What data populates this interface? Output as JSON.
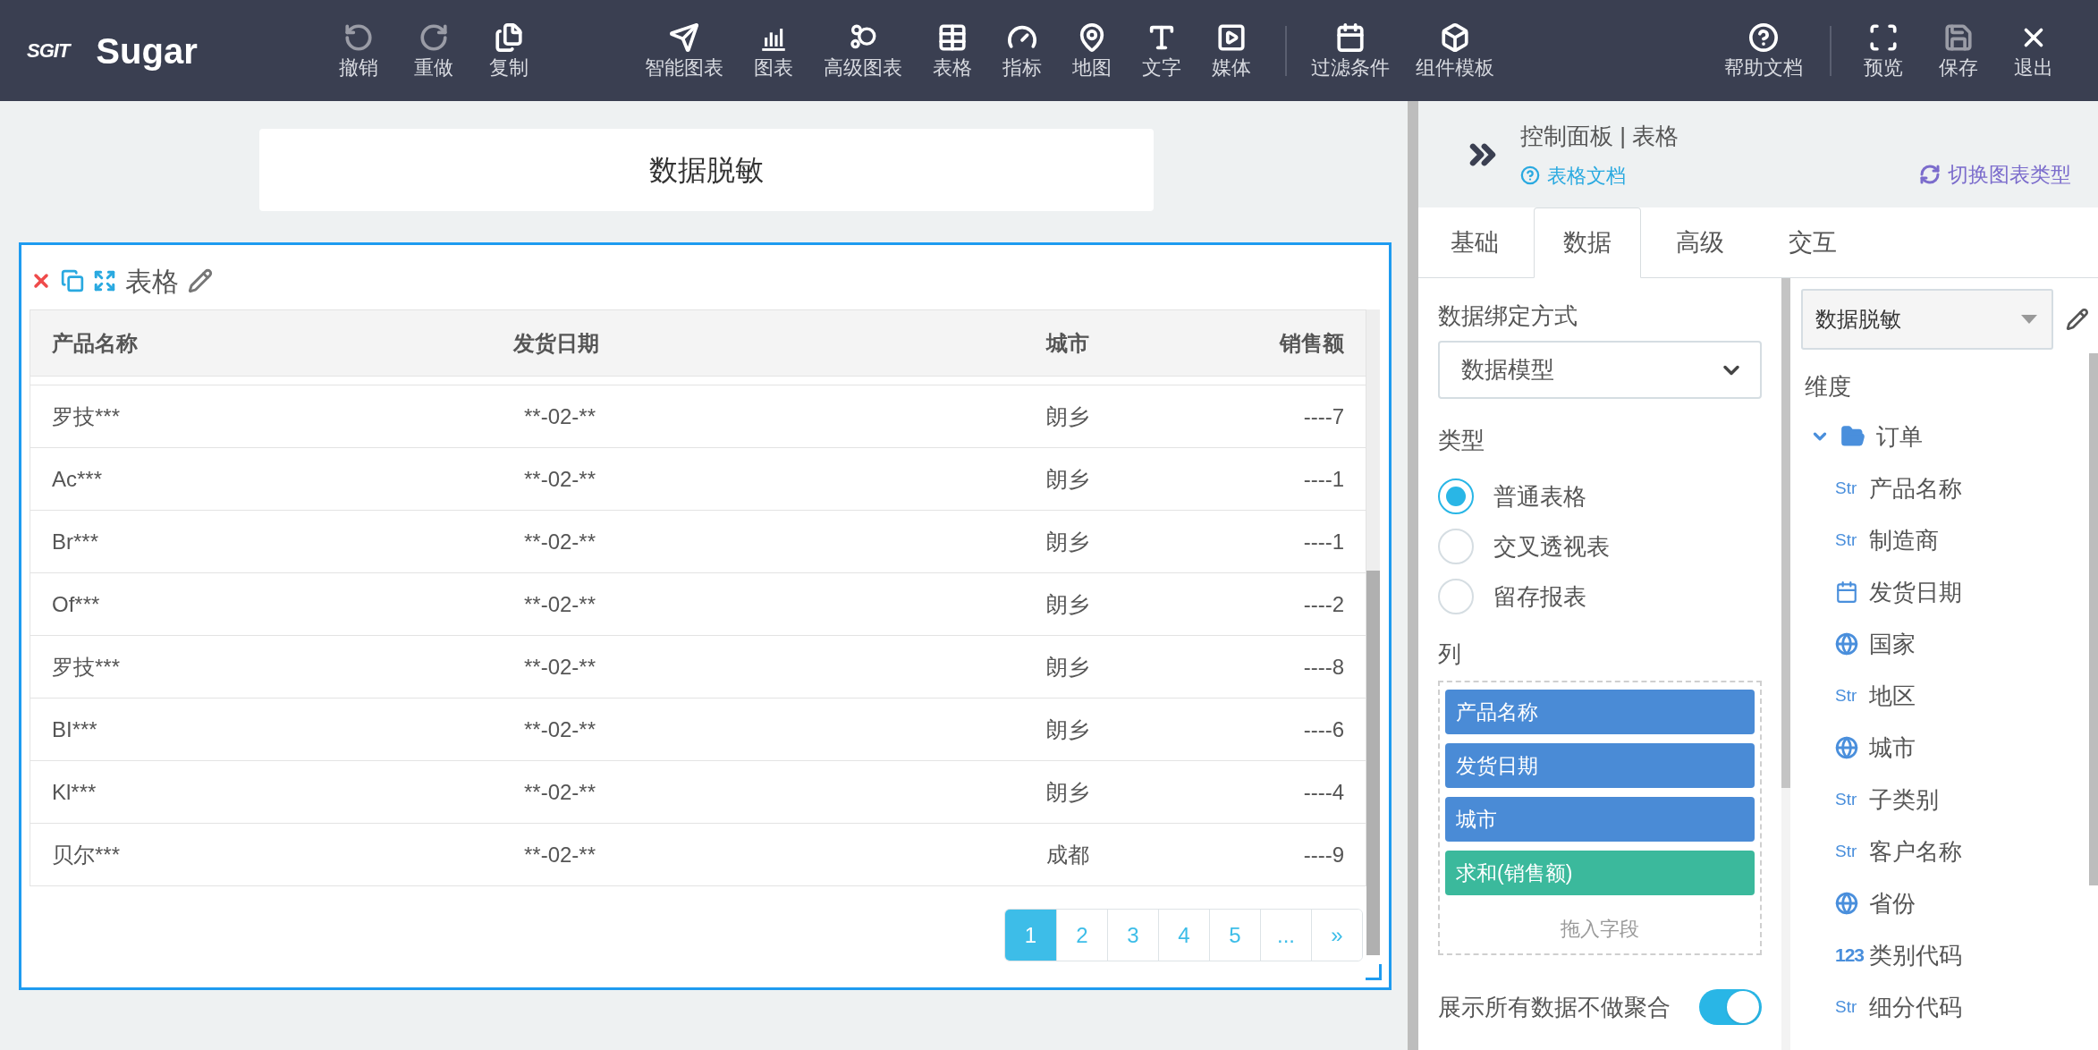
{
  "app": {
    "logo": "SGIT",
    "name": "Sugar"
  },
  "toolbar": {
    "edit": [
      {
        "label": "撤销",
        "disabled": true
      },
      {
        "label": "重做",
        "disabled": true
      },
      {
        "label": "复制",
        "disabled": false
      }
    ],
    "insert": [
      {
        "label": "智能图表",
        "disabled": false
      },
      {
        "label": "图表",
        "disabled": false
      },
      {
        "label": "高级图表",
        "disabled": false
      },
      {
        "label": "表格",
        "disabled": false
      },
      {
        "label": "指标",
        "disabled": false
      },
      {
        "label": "地图",
        "disabled": false
      },
      {
        "label": "文字",
        "disabled": false
      },
      {
        "label": "媒体",
        "disabled": false
      }
    ],
    "filters": [
      {
        "label": "过滤条件",
        "disabled": false
      },
      {
        "label": "组件模板",
        "disabled": false
      }
    ],
    "help": [
      {
        "label": "帮助文档",
        "disabled": false
      }
    ],
    "view": [
      {
        "label": "预览",
        "disabled": false
      },
      {
        "label": "保存",
        "disabled": true
      },
      {
        "label": "退出",
        "disabled": false
      }
    ]
  },
  "canvas": {
    "title": "数据脱敏",
    "widget": {
      "title": "表格",
      "table": {
        "columns": [
          "产品名称",
          "发货日期",
          "城市",
          "销售额"
        ],
        "rows": [
          [
            "罗技***",
            "**-02-**",
            "朗乡",
            "----7"
          ],
          [
            "Ac***",
            "**-02-**",
            "朗乡",
            "----1"
          ],
          [
            "Br***",
            "**-02-**",
            "朗乡",
            "----1"
          ],
          [
            "Of***",
            "**-02-**",
            "朗乡",
            "----2"
          ],
          [
            "罗技***",
            "**-02-**",
            "朗乡",
            "----8"
          ],
          [
            "BI***",
            "**-02-**",
            "朗乡",
            "----6"
          ],
          [
            "Kl***",
            "**-02-**",
            "朗乡",
            "----4"
          ],
          [
            "贝尔***",
            "**-02-**",
            "成都",
            "----9"
          ]
        ]
      },
      "pagination": [
        {
          "label": "1",
          "selected": true
        },
        {
          "label": "2",
          "selected": false
        },
        {
          "label": "3",
          "selected": false
        },
        {
          "label": "4",
          "selected": false
        },
        {
          "label": "5",
          "selected": false
        },
        {
          "label": "...",
          "selected": false
        },
        {
          "label": "»",
          "selected": false
        }
      ]
    }
  },
  "panel": {
    "title": "控制面板 | 表格",
    "doc_link": "表格文档",
    "switch_link": "切换图表类型",
    "tabs": [
      {
        "label": "基础",
        "selected": false
      },
      {
        "label": "数据",
        "selected": true
      },
      {
        "label": "高级",
        "selected": false
      },
      {
        "label": "交互",
        "selected": false
      }
    ],
    "binding": {
      "label": "数据绑定方式",
      "value": "数据模型"
    },
    "type": {
      "label": "类型",
      "options": [
        {
          "label": "普通表格",
          "selected": true
        },
        {
          "label": "交叉透视表",
          "selected": false
        },
        {
          "label": "留存报表",
          "selected": false
        }
      ]
    },
    "columns": {
      "label": "列",
      "fields": [
        {
          "label": "产品名称",
          "kind": "dimension"
        },
        {
          "label": "发货日期",
          "kind": "dimension"
        },
        {
          "label": "城市",
          "kind": "dimension"
        },
        {
          "label": "求和(销售额)",
          "kind": "measure"
        }
      ],
      "drop_hint": "拖入字段"
    },
    "aggregate": {
      "label": "展示所有数据不做聚合",
      "on": true
    },
    "dataset": {
      "value": "数据脱敏"
    },
    "dimensions": {
      "label": "维度",
      "tree": [
        {
          "label": "订单",
          "expanded": true,
          "children": [
            {
              "kind": "str",
              "tag": "Str",
              "label": "产品名称"
            },
            {
              "kind": "str",
              "tag": "Str",
              "label": "制造商"
            },
            {
              "kind": "date",
              "label": "发货日期"
            },
            {
              "kind": "geo",
              "label": "国家"
            },
            {
              "kind": "str",
              "tag": "Str",
              "label": "地区"
            },
            {
              "kind": "geo",
              "label": "城市"
            },
            {
              "kind": "str",
              "tag": "Str",
              "label": "子类别"
            },
            {
              "kind": "str",
              "tag": "Str",
              "label": "客户名称"
            },
            {
              "kind": "geo",
              "label": "省份"
            },
            {
              "kind": "num",
              "tag": "123",
              "label": "类别代码"
            },
            {
              "kind": "str",
              "tag": "Str",
              "label": "细分代码"
            }
          ]
        }
      ]
    }
  }
}
